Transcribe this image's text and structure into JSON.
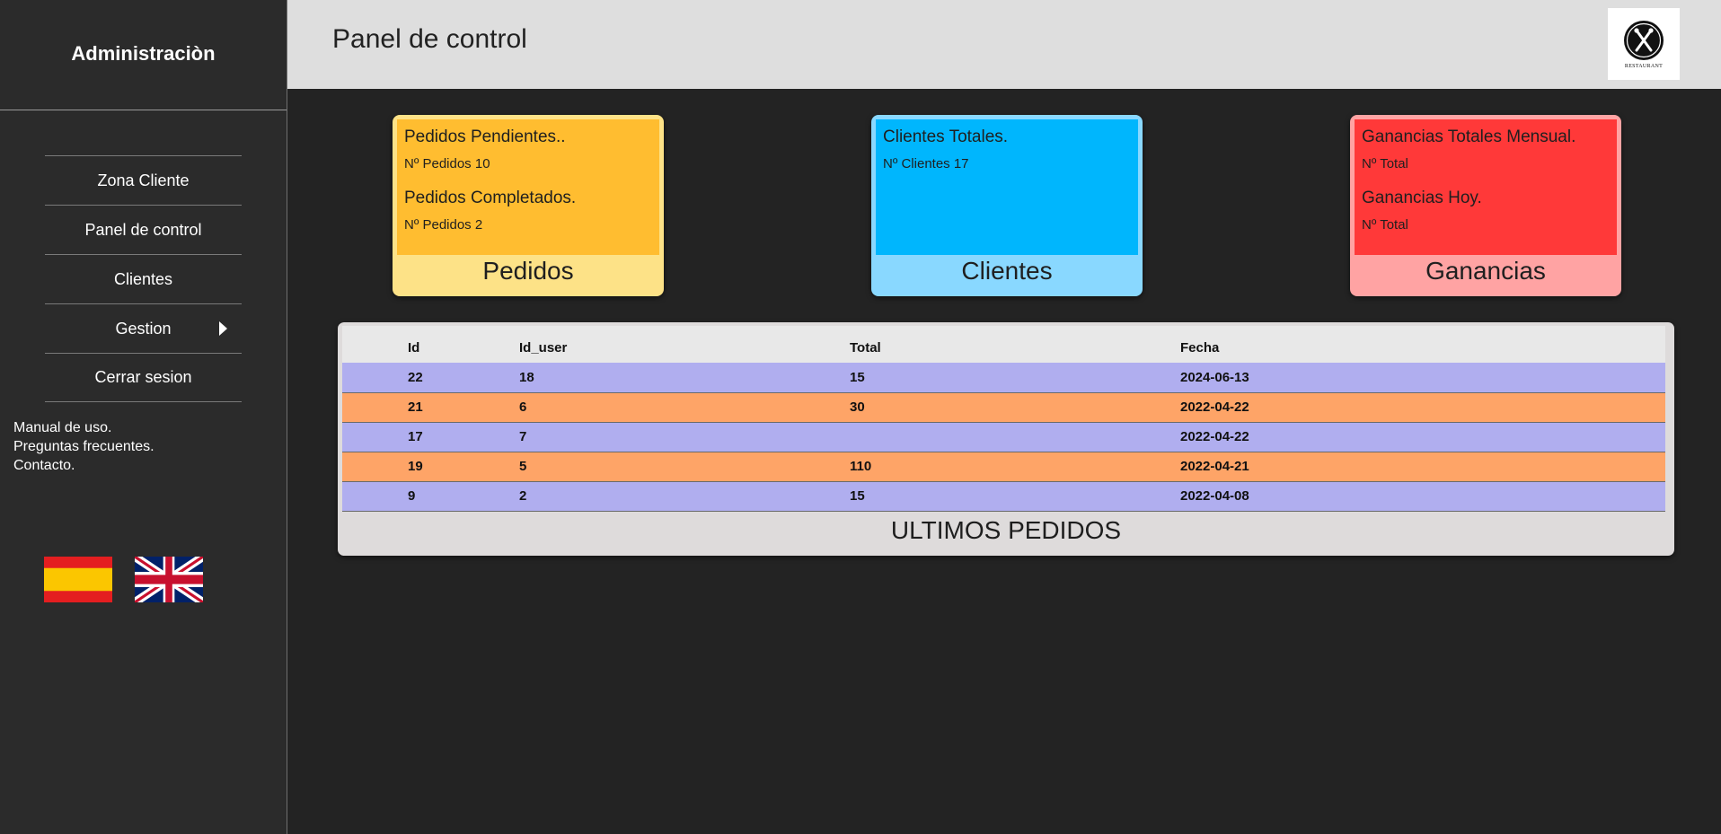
{
  "sidebar": {
    "title": "Administraciòn",
    "nav": [
      {
        "label": "Zona Cliente"
      },
      {
        "label": "Panel de control"
      },
      {
        "label": "Clientes"
      },
      {
        "label": "Gestion"
      },
      {
        "label": "Cerrar sesion"
      }
    ],
    "links": [
      "Manual de uso.",
      "Preguntas frecuentes.",
      "Contacto."
    ],
    "flags": [
      "spain-flag",
      "uk-flag"
    ]
  },
  "header": {
    "title": "Panel de control",
    "logo_text": "RESTAURANT"
  },
  "cards": {
    "pedidos": {
      "line1_title": "Pedidos Pendientes..",
      "line1_value": "Nº Pedidos 10",
      "line2_title": "Pedidos Completados.",
      "line2_value": "Nº Pedidos 2",
      "footer": "Pedidos"
    },
    "clientes": {
      "line1_title": "Clientes Totales.",
      "line1_value": "Nº Clientes 17",
      "footer": "Clientes"
    },
    "ganancias": {
      "line1_title": "Ganancias Totales Mensual.",
      "line1_value": "Nº Total",
      "line2_title": "Ganancias Hoy.",
      "line2_value": "Nº Total",
      "footer": "Ganancias"
    }
  },
  "orders_table": {
    "columns": [
      "Id",
      "Id_user",
      "Total",
      "Fecha"
    ],
    "rows": [
      [
        "22",
        "18",
        "15",
        "2024-06-13"
      ],
      [
        "21",
        "6",
        "30",
        "2022-04-22"
      ],
      [
        "17",
        "7",
        "",
        "2022-04-22"
      ],
      [
        "19",
        "5",
        "110",
        "2022-04-21"
      ],
      [
        "9",
        "2",
        "15",
        "2022-04-08"
      ]
    ],
    "title": "ULTIMOS PEDIDOS"
  },
  "colors": {
    "pedidos": "#ffbd30",
    "clientes": "#00b6fd",
    "ganancias": "#ff3939",
    "row_a": "#b0aeef",
    "row_b": "#fea467"
  }
}
